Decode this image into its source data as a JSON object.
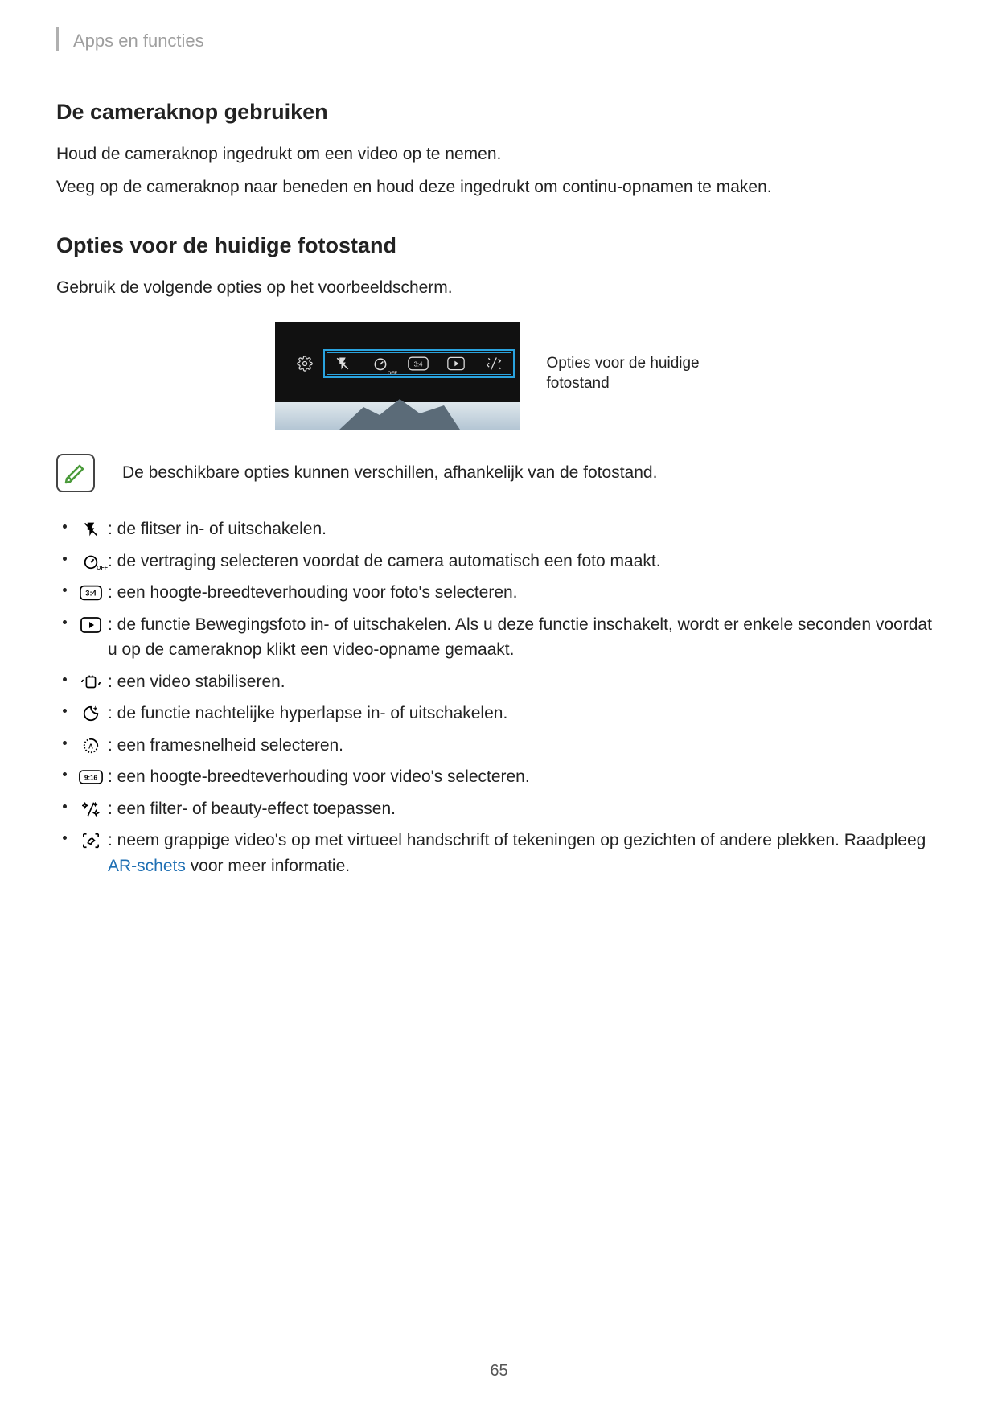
{
  "header": {
    "breadcrumb": "Apps en functies"
  },
  "section1": {
    "title": "De cameraknop gebruiken",
    "p1": "Houd de cameraknop ingedrukt om een video op te nemen.",
    "p2": "Veeg op de cameraknop naar beneden en houd deze ingedrukt om continu-opnamen te maken."
  },
  "section2": {
    "title": "Opties voor de huidige fotostand",
    "intro": "Gebruik de volgende opties op het voorbeeldscherm.",
    "callout": "Opties voor de huidige fotostand",
    "preview_icons": {
      "settings": "settings",
      "flash": "flash-off",
      "timer": "timer-off",
      "timer_sub": "OFF",
      "ratio": "3:4",
      "motion": "motion-photo",
      "effects": "filter-effects"
    },
    "note": "De beschikbare opties kunnen verschillen, afhankelijk van de fotostand.",
    "options": [
      {
        "icon": "flash-off",
        "text": " : de flitser in- of uitschakelen."
      },
      {
        "icon": "timer-off",
        "text": " : de vertraging selecteren voordat de camera automatisch een foto maakt."
      },
      {
        "icon": "ratio-3-4",
        "text": " : een hoogte-breedteverhouding voor foto's selecteren."
      },
      {
        "icon": "motion-photo",
        "text": " : de functie Bewegingsfoto in- of uitschakelen. Als u deze functie inschakelt, wordt er enkele seconden voordat u op de cameraknop klikt een video-opname gemaakt."
      },
      {
        "icon": "stabilize",
        "text": " : een video stabiliseren."
      },
      {
        "icon": "night-hyperlapse",
        "text": " : de functie nachtelijke hyperlapse in- of uitschakelen."
      },
      {
        "icon": "framerate",
        "text": " : een framesnelheid selecteren."
      },
      {
        "icon": "ratio-9-16",
        "text": " : een hoogte-breedteverhouding voor video's selecteren."
      },
      {
        "icon": "filter-effects",
        "text": " : een filter- of beauty-effect toepassen."
      },
      {
        "icon": "ar-doodle",
        "text_pre": " : neem grappige video's op met virtueel handschrift of tekeningen op gezichten of andere plekken. Raadpleeg ",
        "link": "AR-schets",
        "text_post": " voor meer informatie."
      }
    ]
  },
  "page_number": "65"
}
